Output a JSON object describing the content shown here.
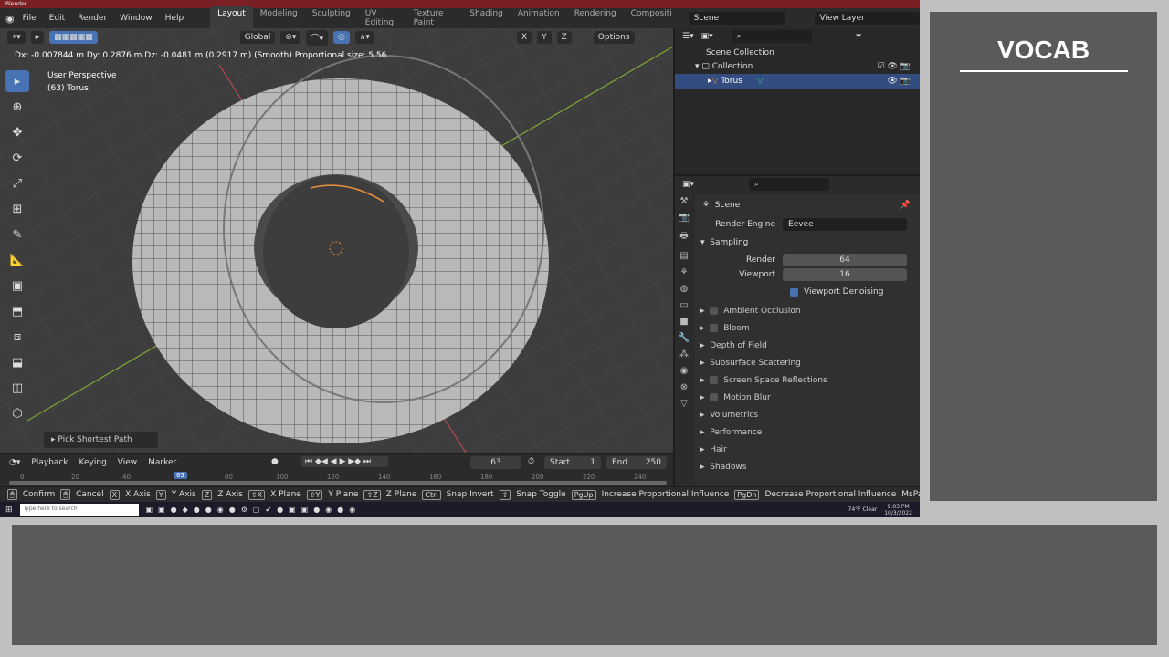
{
  "app": {
    "title": "Blender"
  },
  "menu": [
    "File",
    "Edit",
    "Render",
    "Window",
    "Help"
  ],
  "workspaces": [
    "Layout",
    "Modeling",
    "Sculpting",
    "UV Editing",
    "Texture Paint",
    "Shading",
    "Animation",
    "Rendering",
    "Compositi"
  ],
  "scene": "Scene",
  "view_layer": "View Layer",
  "viewport": {
    "orientation": "Global",
    "axes": [
      "X",
      "Y",
      "Z"
    ],
    "options": "Options",
    "header_info": "Dx: -0.007844 m  Dy: 0.2876 m  Dz: -0.0481 m (0.2917 m) (Smooth)   Proportional size: 5.56",
    "view_name": "User Perspective",
    "object_info": "(63) Torus",
    "last_op": "Pick Shortest Path"
  },
  "timeline": {
    "menus": [
      "Playback",
      "Keying",
      "View",
      "Marker"
    ],
    "current_frame": "63",
    "start_label": "Start",
    "start": "1",
    "end_label": "End",
    "end": "250",
    "ticks": [
      "0",
      "20",
      "40",
      "60",
      "80",
      "100",
      "120",
      "140",
      "160",
      "180",
      "200",
      "220",
      "240"
    ]
  },
  "status": [
    {
      "k": "🖱",
      "t": "Confirm"
    },
    {
      "k": "🖱",
      "t": "Cancel"
    },
    {
      "k": "X",
      "t": "X Axis"
    },
    {
      "k": "Y",
      "t": "Y Axis"
    },
    {
      "k": "Z",
      "t": "Z Axis"
    },
    {
      "k": "⇧X",
      "t": "X Plane"
    },
    {
      "k": "⇧Y",
      "t": "Y Plane"
    },
    {
      "k": "⇧Z",
      "t": "Z Plane"
    },
    {
      "k": "Ctrl",
      "t": "Snap Invert"
    },
    {
      "k": "⇧",
      "t": "Snap Toggle"
    },
    {
      "k": "PgUp",
      "t": "Increase Proportional Influence"
    },
    {
      "k": "PgDn",
      "t": "Decrease Proportional Influence"
    },
    {
      "k": "",
      "t": "MsPan"
    }
  ],
  "taskbar": {
    "search_placeholder": "Type here to search",
    "weather": "74°F Clear",
    "time": "9:03 PM",
    "date": "10/3/2022"
  },
  "outliner": {
    "root": "Scene Collection",
    "collection": "Collection",
    "object": "Torus"
  },
  "properties": {
    "context": "Scene",
    "render_engine_label": "Render Engine",
    "render_engine": "Eevee",
    "sampling": "Sampling",
    "render_label": "Render",
    "render": "64",
    "viewport_label": "Viewport",
    "viewport": "16",
    "denoise": "Viewport Denoising",
    "panels": [
      {
        "t": "Ambient Occlusion",
        "c": true
      },
      {
        "t": "Bloom",
        "c": true
      },
      {
        "t": "Depth of Field",
        "c": false
      },
      {
        "t": "Subsurface Scattering",
        "c": false
      },
      {
        "t": "Screen Space Reflections",
        "c": true
      },
      {
        "t": "Motion Blur",
        "c": true
      },
      {
        "t": "Volumetrics",
        "c": false
      },
      {
        "t": "Performance",
        "c": false
      },
      {
        "t": "Hair",
        "c": false
      },
      {
        "t": "Shadows",
        "c": false
      }
    ]
  },
  "side": {
    "title": "VOCAB"
  }
}
